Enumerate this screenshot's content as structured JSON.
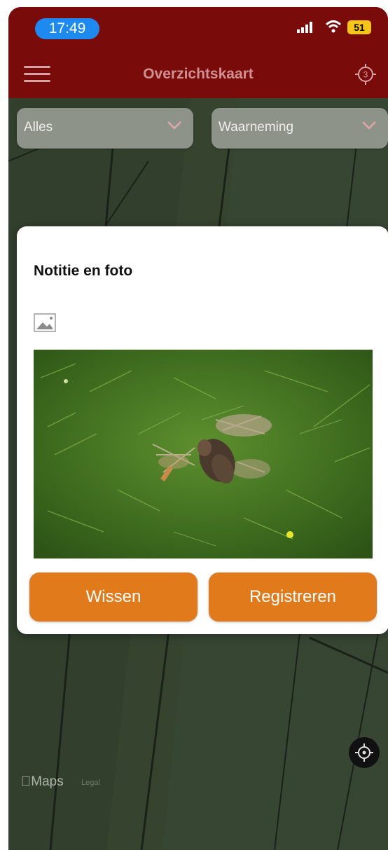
{
  "status_bar": {
    "time": "17:49",
    "battery": "51"
  },
  "nav": {
    "title": "Overzichtskaart",
    "badge_count": "3"
  },
  "filters": {
    "category": "Alles",
    "type": "Waarneming"
  },
  "dialog": {
    "title": "Notitie en foto",
    "clear_label": "Wissen",
    "register_label": "Registreren"
  },
  "map": {
    "attribution": "Maps",
    "legal": "Legal"
  },
  "colors": {
    "header": "#7a0b0b",
    "accent": "#e07a1b",
    "time_pill": "#1e8af0"
  },
  "icons": [
    "menu-icon",
    "layers-count-icon",
    "image-add-icon",
    "chevron-down-icon",
    "locate-icon",
    "apple-logo-icon",
    "wifi-icon",
    "signal-icon"
  ]
}
